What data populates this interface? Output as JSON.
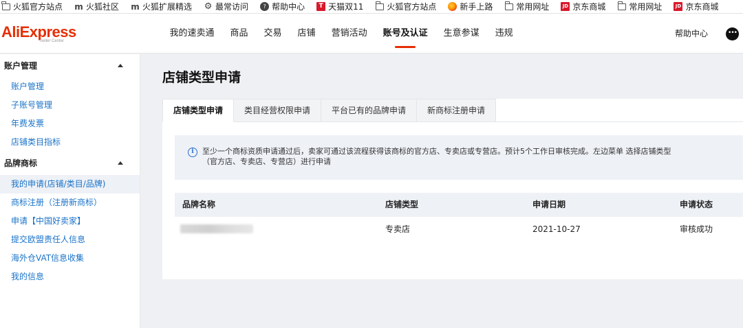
{
  "bookmarks": [
    {
      "icon": "folder-icon",
      "label": "火狐官方站点"
    },
    {
      "icon": "m-icon",
      "label": "火狐社区"
    },
    {
      "icon": "m-icon",
      "label": "火狐扩展精选"
    },
    {
      "icon": "gear-icon",
      "label": "最常访问"
    },
    {
      "icon": "help-circle-icon",
      "label": "帮助中心"
    },
    {
      "icon": "tmall-icon",
      "label": "天猫双11"
    },
    {
      "icon": "folder-icon",
      "label": "火狐官方站点"
    },
    {
      "icon": "firefox-icon",
      "label": "新手上路"
    },
    {
      "icon": "folder-icon",
      "label": "常用网址"
    },
    {
      "icon": "jd-icon",
      "label": "京东商城"
    },
    {
      "icon": "folder-icon",
      "label": "常用网址"
    },
    {
      "icon": "jd-icon",
      "label": "京东商城"
    }
  ],
  "header": {
    "logo_text": "AliExpress",
    "logo_subtext": "Seller Center",
    "nav": [
      "我的速卖通",
      "商品",
      "交易",
      "店铺",
      "营销活动",
      "账号及认证",
      "生意参谋",
      "违规"
    ],
    "active_nav": "账号及认证",
    "help_label": "帮助中心",
    "brand_color": "#e62e04"
  },
  "sidebar": {
    "groups": [
      {
        "title": "账户管理",
        "items": [
          "账户管理",
          "子账号管理",
          "年费发票",
          "店铺类目指标"
        ]
      },
      {
        "title": "品牌商标",
        "items": [
          "我的申请(店铺/类目/品牌)",
          "商标注册（注册新商标）",
          "申请【中国好卖家】",
          "提交欧盟责任人信息",
          "海外仓VAT信息收集",
          "我的信息"
        ]
      }
    ],
    "selected_item": "我的申请(店铺/类目/品牌)",
    "link_color": "#1a73c9"
  },
  "main": {
    "title": "店铺类型申请",
    "tabs": [
      "店铺类型申请",
      "类目经营权限申请",
      "平台已有的品牌申请",
      "新商标注册申请"
    ],
    "active_tab": "店铺类型申请",
    "notice_line1": "至少一个商标资质申请通过后，卖家可通过该流程获得该商标的官方店、专卖店或专营店。预计5个工作日审核完成。左边菜单 选择店铺类型",
    "notice_line2": "（官方店、专卖店、专营店）进行申请",
    "table": {
      "headers": [
        "品牌名称",
        "店铺类型",
        "申请日期",
        "申请状态"
      ],
      "rows": [
        {
          "brand": "",
          "store_type": "专卖店",
          "date": "2021-10-27",
          "status": "审核成功"
        }
      ]
    }
  }
}
